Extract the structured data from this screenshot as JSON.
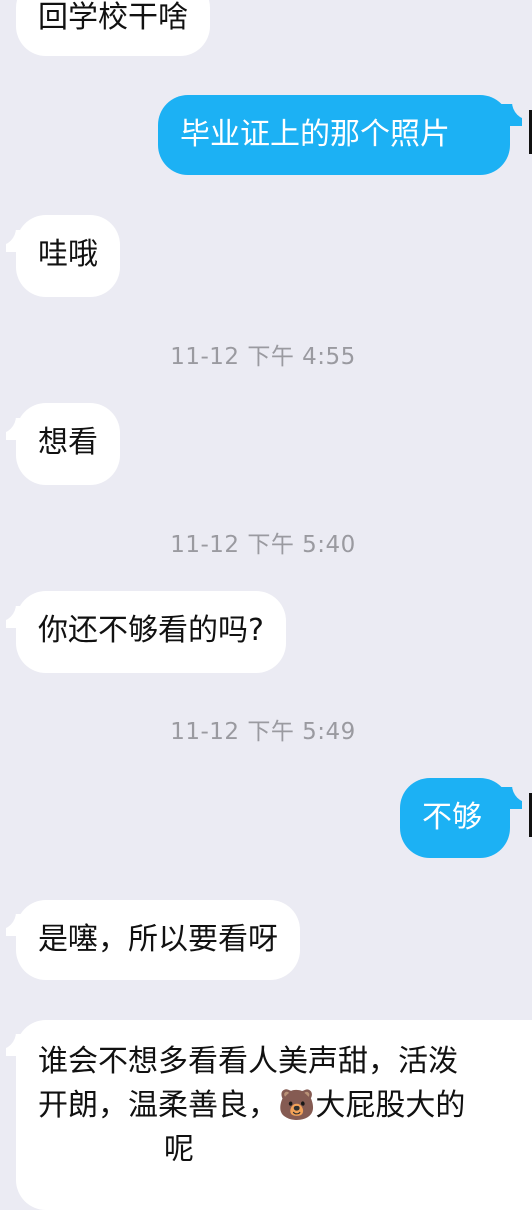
{
  "messages": [
    {
      "side": "in",
      "text": "回学校干啥"
    },
    {
      "side": "out",
      "text": "毕业证上的那个照片"
    },
    {
      "side": "in",
      "text": "哇哦"
    },
    {
      "type": "timestamp",
      "text": "11-12 下午 4:55"
    },
    {
      "side": "in",
      "text": "想看"
    },
    {
      "type": "timestamp",
      "text": "11-12 下午 5:40"
    },
    {
      "side": "in",
      "text": "你还不够看的吗?"
    },
    {
      "type": "timestamp",
      "text": "11-12 下午 5:49"
    },
    {
      "side": "out",
      "text": "不够"
    },
    {
      "side": "in",
      "text": "是噻，所以要看呀"
    },
    {
      "side": "in",
      "line1": "谁会不想多看看人美声甜，活泼",
      "line2_before_emoji": "开朗，温柔善良，",
      "emoji": "🐻",
      "line2_after_emoji": "大屁股大的",
      "line3_visible": "呢"
    }
  ],
  "colors": {
    "background": "#ebebf3",
    "incoming_bubble": "#ffffff",
    "outgoing_bubble": "#1cb1f4",
    "timestamp_text": "#9a9aa0"
  }
}
